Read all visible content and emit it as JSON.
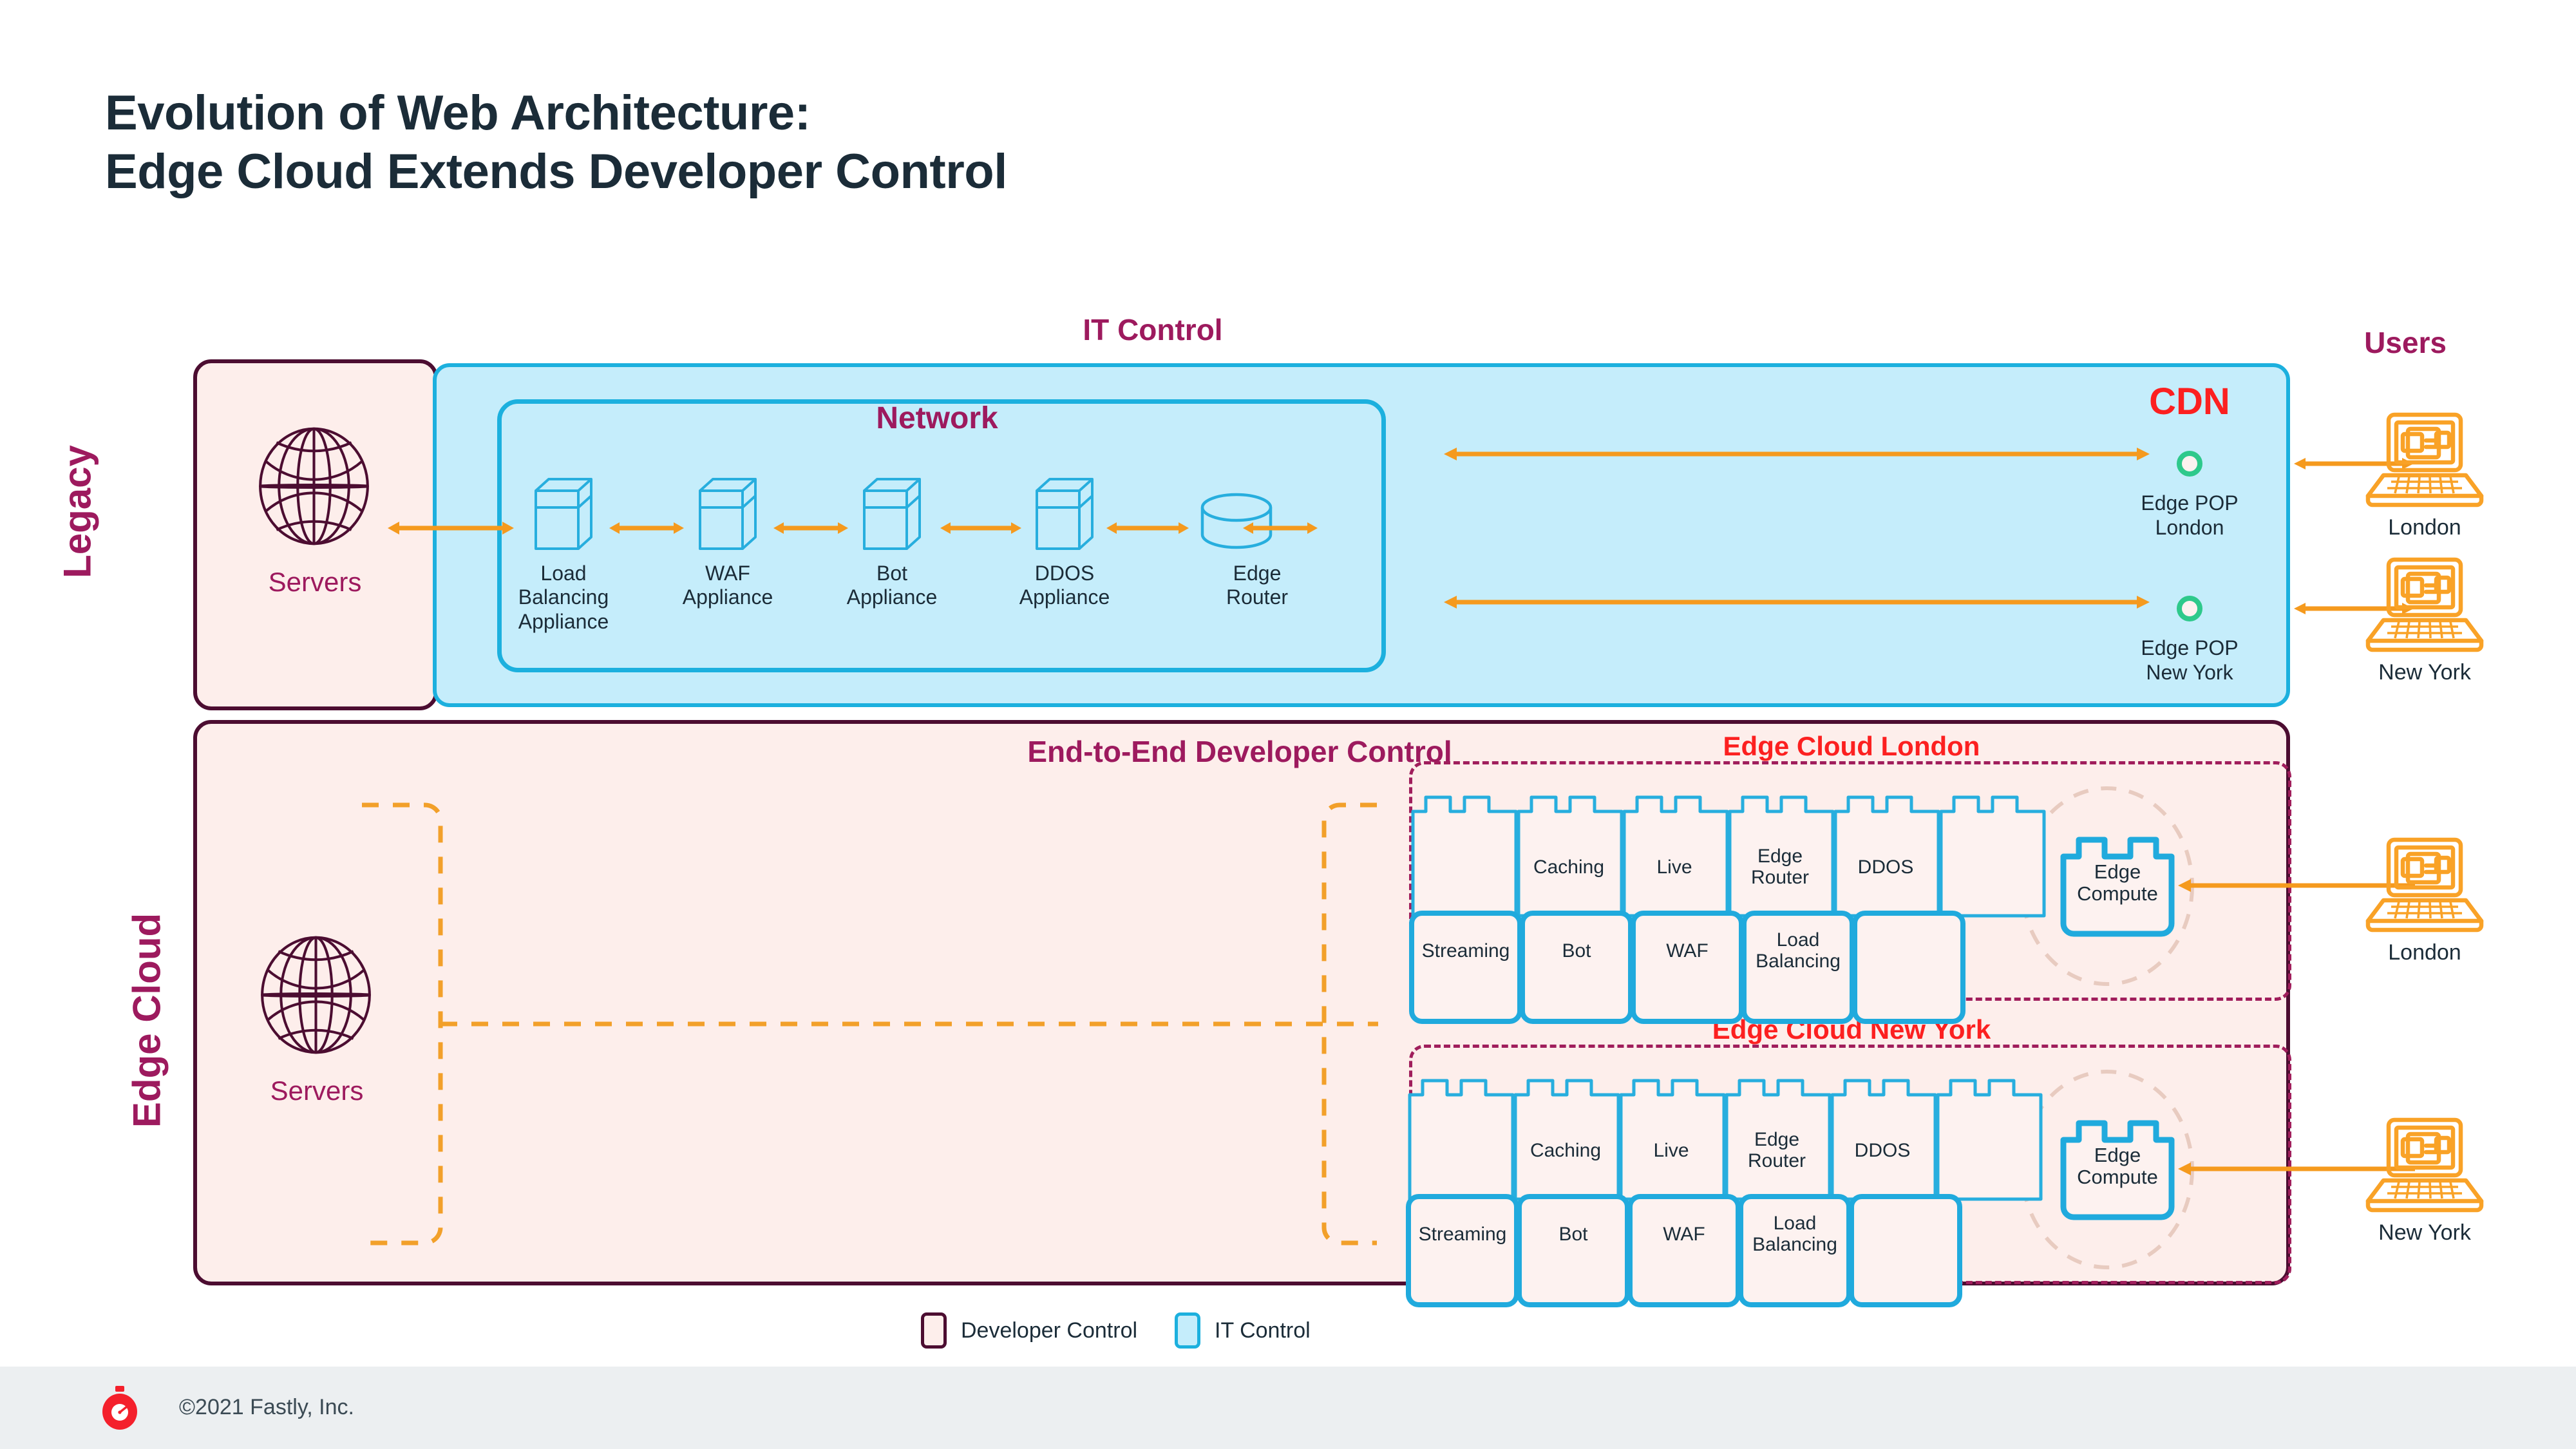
{
  "title": "Evolution of Web Architecture:\nEdge Cloud Extends Developer Control",
  "row_labels": {
    "legacy": "Legacy",
    "edge_cloud": "Edge Cloud"
  },
  "headings": {
    "it_control": "IT Control",
    "users": "Users",
    "cdn": "CDN",
    "end_to_end": "End-to-End Developer Control",
    "edge_cloud_london": "Edge Cloud London",
    "edge_cloud_newyork": "Edge Cloud New York",
    "network": "Network"
  },
  "legacy": {
    "servers_label": "Servers",
    "appliances": [
      {
        "label": "Load\nBalancing\nAppliance",
        "icon": "server-box-icon"
      },
      {
        "label": "WAF\nAppliance",
        "icon": "server-box-icon"
      },
      {
        "label": "Bot\nAppliance",
        "icon": "server-box-icon"
      },
      {
        "label": "DDOS\nAppliance",
        "icon": "server-box-icon"
      },
      {
        "label": "Edge\nRouter",
        "icon": "cylinder-router-icon"
      }
    ],
    "pops": [
      {
        "label": "Edge POP\nLondon"
      },
      {
        "label": "Edge POP\nNew York"
      }
    ]
  },
  "edge_cloud": {
    "servers_label": "Servers",
    "london": {
      "top_row": [
        "",
        "Caching",
        "Live",
        "Edge\nRouter",
        "DDOS",
        ""
      ],
      "bottom_row": [
        "Streaming",
        "Bot",
        "WAF",
        "Load\nBalancing",
        ""
      ],
      "compute": "Edge\nCompute"
    },
    "newyork": {
      "top_row": [
        "",
        "Caching",
        "Live",
        "Edge\nRouter",
        "DDOS",
        ""
      ],
      "bottom_row": [
        "Streaming",
        "Bot",
        "WAF",
        "Load\nBalancing",
        ""
      ],
      "compute": "Edge\nCompute"
    }
  },
  "users": [
    {
      "label": "London"
    },
    {
      "label": "New York"
    },
    {
      "label": "London"
    },
    {
      "label": "New York"
    }
  ],
  "legend": [
    {
      "label": "Developer Control",
      "swatch": "developer-control"
    },
    {
      "label": "IT Control",
      "swatch": "it-control"
    }
  ],
  "footer": {
    "copyright": "©2021 Fastly, Inc.",
    "logo": "fastly-stopwatch-logo"
  },
  "colors": {
    "title_text": "#1b2c38",
    "magenta": "#9d1a5e",
    "dark_plum": "#4c0d31",
    "red": "#fc2020",
    "cyan_border": "#1cb0de",
    "cyan_fill": "#c5edfb",
    "peach_fill": "#fdeeeb",
    "orange": "#f59a1e",
    "green_pop": "#2ec98b",
    "footer_bg": "#eceff1",
    "fastly_red": "#f4202c"
  }
}
